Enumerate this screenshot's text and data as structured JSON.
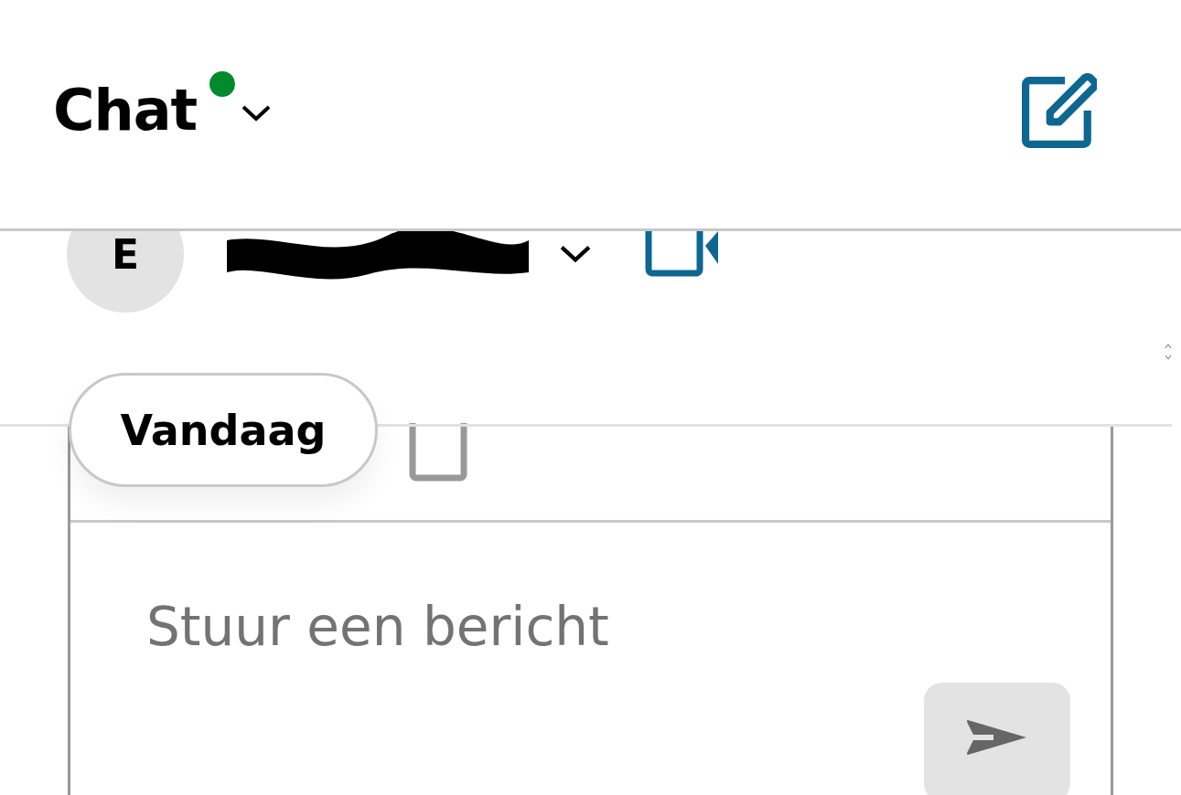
{
  "header": {
    "title": "Chat",
    "online": true
  },
  "conversation": {
    "avatar_initial": "E",
    "name_redacted": true
  },
  "date_badge": "Vandaag",
  "composer": {
    "placeholder": "Stuur een bericht",
    "send_disabled": true
  }
}
